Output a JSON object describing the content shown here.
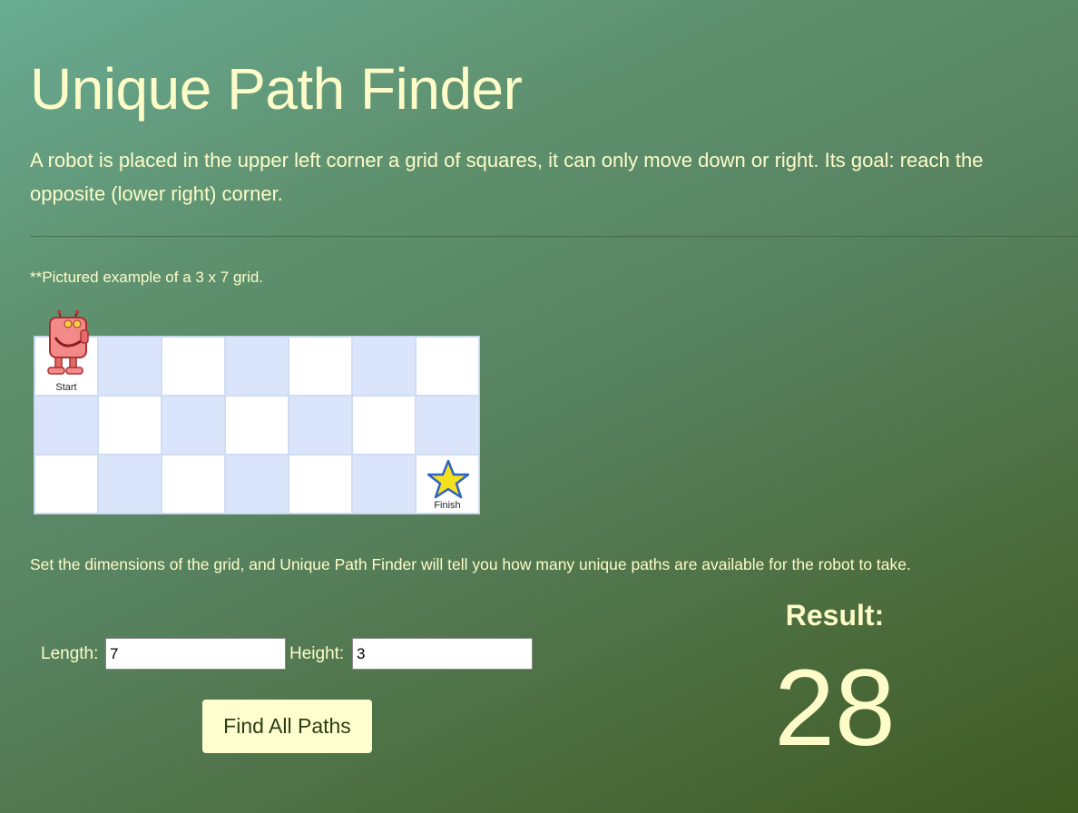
{
  "header": {
    "title": "Unique Path Finder",
    "intro": "A robot is placed in the upper left corner a grid of squares, it can only move down or right. Its goal: reach the opposite (lower right) corner."
  },
  "example": {
    "caption": "**Pictured example of a 3 x 7 grid.",
    "rows": 3,
    "columns": 7,
    "start_label": "Start",
    "finish_label": "Finish",
    "cell_color": "#ffffff",
    "shade_color": "#dae5fb",
    "robot_icon": "robot-icon",
    "finish_icon": "star-icon"
  },
  "description": "Set the dimensions of the grid, and Unique Path Finder will tell you how many unique paths are available for the robot to take.",
  "form": {
    "length_label": "Length:",
    "length_value": "7",
    "height_label": "Height:",
    "height_value": "3",
    "submit_label": "Find All Paths"
  },
  "result": {
    "label": "Result:",
    "value": "28"
  },
  "colors": {
    "text": "#fdfcc8",
    "button_bg": "#fefece",
    "button_text": "#2c3d16"
  }
}
